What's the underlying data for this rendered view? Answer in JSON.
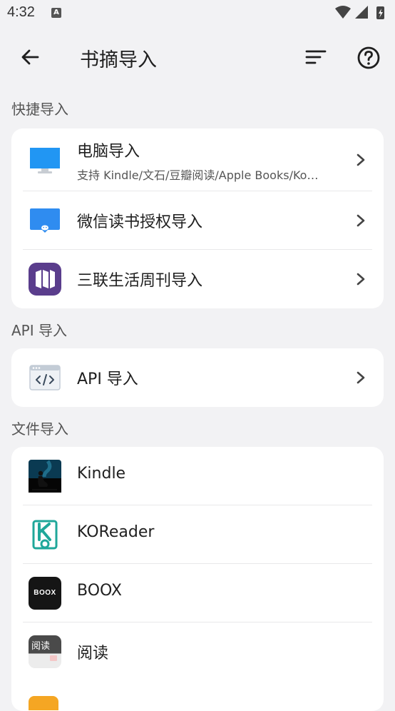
{
  "status_bar": {
    "time": "4:32",
    "notif_letter": "A"
  },
  "app_bar": {
    "title": "书摘导入"
  },
  "sections": {
    "quick": {
      "header": "快捷导入",
      "items": [
        {
          "label": "电脑导入",
          "subtitle": "支持 Kindle/文石/豆瓣阅读/Apple Books/Ko…"
        },
        {
          "label": "微信读书授权导入"
        },
        {
          "label": "三联生活周刊导入"
        }
      ]
    },
    "api": {
      "header": "API 导入",
      "items": [
        {
          "label": "API 导入"
        }
      ]
    },
    "file": {
      "header": "文件导入",
      "items": [
        {
          "label": "Kindle"
        },
        {
          "label": "KOReader"
        },
        {
          "label": "BOOX",
          "icon_text": "BOOX"
        },
        {
          "label": "阅读",
          "icon_text": "阅读"
        }
      ]
    }
  },
  "colors": {
    "background": "#f2f2f4",
    "card": "#ffffff",
    "computer_blue": "#2196f3",
    "wechat_blue": "#2f8cf0",
    "sanlian_purple": "#5a3d8c",
    "koreader_teal": "#1fa79a"
  }
}
